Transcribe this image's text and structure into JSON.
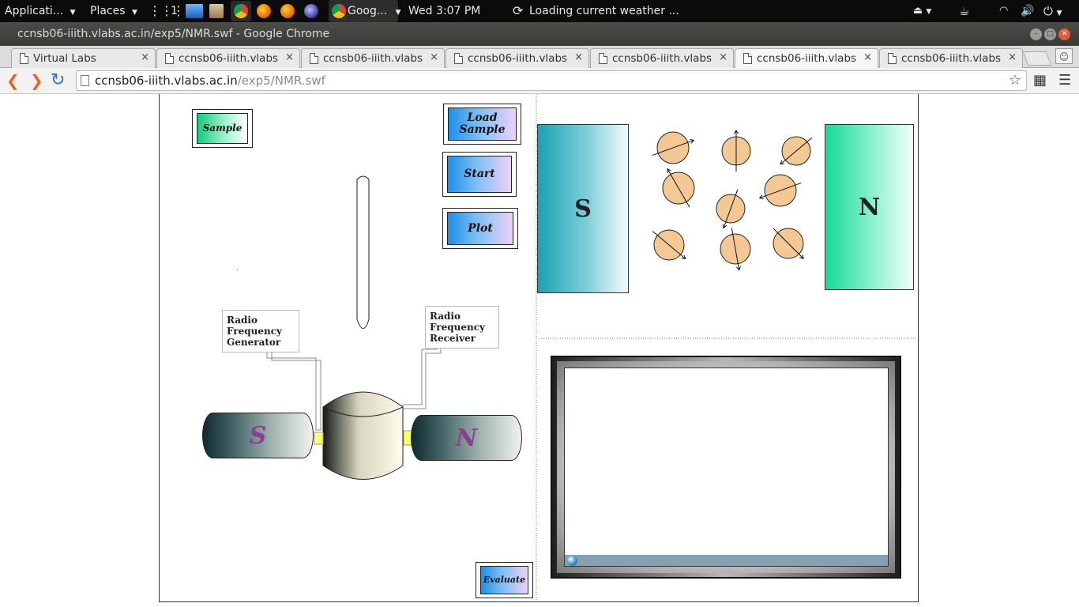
{
  "topbar": {
    "applications": "Applicati...",
    "places": "Places",
    "workspace": "1",
    "chrome_task": "Goog...",
    "clock": "Wed  3:07 PM",
    "weather": "Loading current weather ...",
    "icons": [
      "workspace-grid-icon",
      "screen-icon",
      "files-icon",
      "chrome-icon",
      "firefox-icon",
      "firefox-icon",
      "eclipse-icon",
      "refresh-icon",
      "eject-icon",
      "coffee-icon",
      "wifi-icon",
      "volume-icon",
      "power-icon"
    ]
  },
  "window": {
    "title": "ccnsb06-iiith.vlabs.ac.in/exp5/NMR.swf - Google Chrome"
  },
  "tabs": [
    {
      "label": "Virtual Labs"
    },
    {
      "label": "ccnsb06-iiith.vlabs"
    },
    {
      "label": "ccnsb06-iiith.vlabs"
    },
    {
      "label": "ccnsb06-iiith.vlabs"
    },
    {
      "label": "ccnsb06-iiith.vlabs"
    },
    {
      "label": "ccnsb06-iiith.vlabs"
    },
    {
      "label": "ccnsb06-iiith.vlabs"
    }
  ],
  "tab_close": "×",
  "omnibox": {
    "host": "ccnsb06-iiith.vlabs.ac.in",
    "path": "/exp5/NMR.swf"
  },
  "sim": {
    "sample_button": "Sample",
    "load_sample_button": "Load Sample",
    "start_button": "Start",
    "plot_button": "Plot",
    "evaluate_button": "Evaluate",
    "rf_generator": "Radio Frequency Generator",
    "rf_receiver": "Radio Frequency Receiver",
    "magnet_left": "S",
    "magnet_right": "N",
    "big_magnet_south": "S",
    "big_magnet_north": "N"
  },
  "colors": {
    "accent_blue": "#1e8fe6",
    "accent_green": "#18c97a",
    "magnet_letter": "#8a3c96",
    "nucleus": "#f3c894",
    "rf_connector": "#ffff66"
  }
}
